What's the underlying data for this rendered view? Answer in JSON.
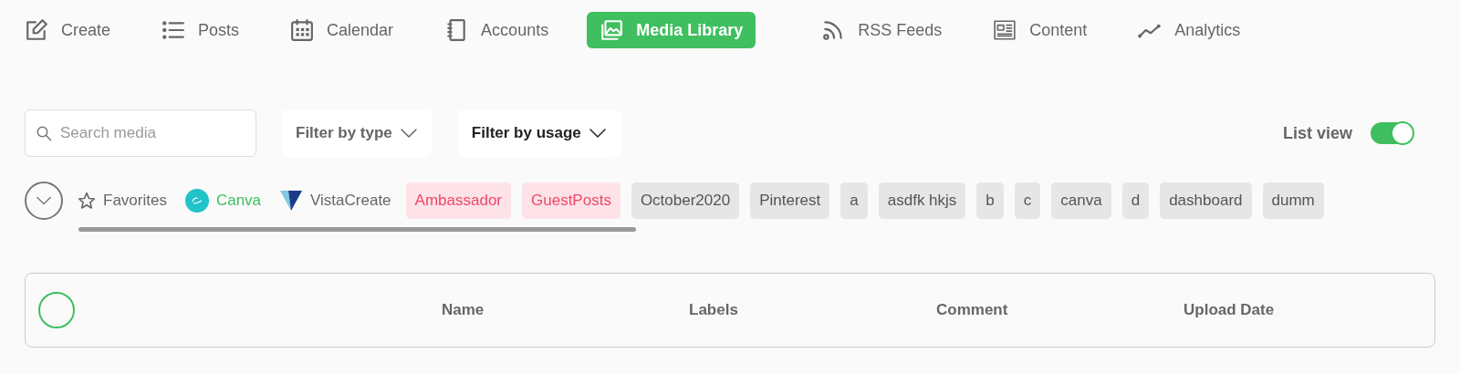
{
  "nav": [
    {
      "label": "Create",
      "selected": false
    },
    {
      "label": "Posts",
      "selected": false
    },
    {
      "label": "Calendar",
      "selected": false
    },
    {
      "label": "Accounts",
      "selected": false
    },
    {
      "label": "Media Library",
      "selected": true
    },
    {
      "label": "RSS Feeds",
      "selected": false
    },
    {
      "label": "Content",
      "selected": false
    },
    {
      "label": "Analytics",
      "selected": false
    }
  ],
  "search": {
    "placeholder": "Search media"
  },
  "filters": [
    {
      "label": "Filter by type",
      "active": false
    },
    {
      "label": "Filter by usage",
      "active": true
    }
  ],
  "list_view": {
    "label": "List view",
    "on": true
  },
  "tags": [
    {
      "kind": "favorites",
      "label": "Favorites"
    },
    {
      "kind": "canva",
      "label": "Canva"
    },
    {
      "kind": "vistacreate",
      "label": "VistaCreate"
    },
    {
      "kind": "label",
      "label": "Ambassador",
      "highlighted": true
    },
    {
      "kind": "label",
      "label": "GuestPosts",
      "highlighted": true
    },
    {
      "kind": "label",
      "label": "October2020",
      "highlighted": false
    },
    {
      "kind": "label",
      "label": "Pinterest",
      "highlighted": false
    },
    {
      "kind": "label",
      "label": "a",
      "highlighted": false
    },
    {
      "kind": "label",
      "label": "asdfk hkjs",
      "highlighted": false
    },
    {
      "kind": "label",
      "label": "b",
      "highlighted": false
    },
    {
      "kind": "label",
      "label": "c",
      "highlighted": false
    },
    {
      "kind": "label",
      "label": "canva",
      "highlighted": false
    },
    {
      "kind": "label",
      "label": "d",
      "highlighted": false
    },
    {
      "kind": "label",
      "label": "dashboard",
      "highlighted": false
    },
    {
      "kind": "label",
      "label": "dumm",
      "highlighted": false
    }
  ],
  "table": {
    "select_all": {
      "checked": false
    },
    "columns": [
      "Name",
      "Labels",
      "Comment",
      "Upload Date"
    ]
  }
}
